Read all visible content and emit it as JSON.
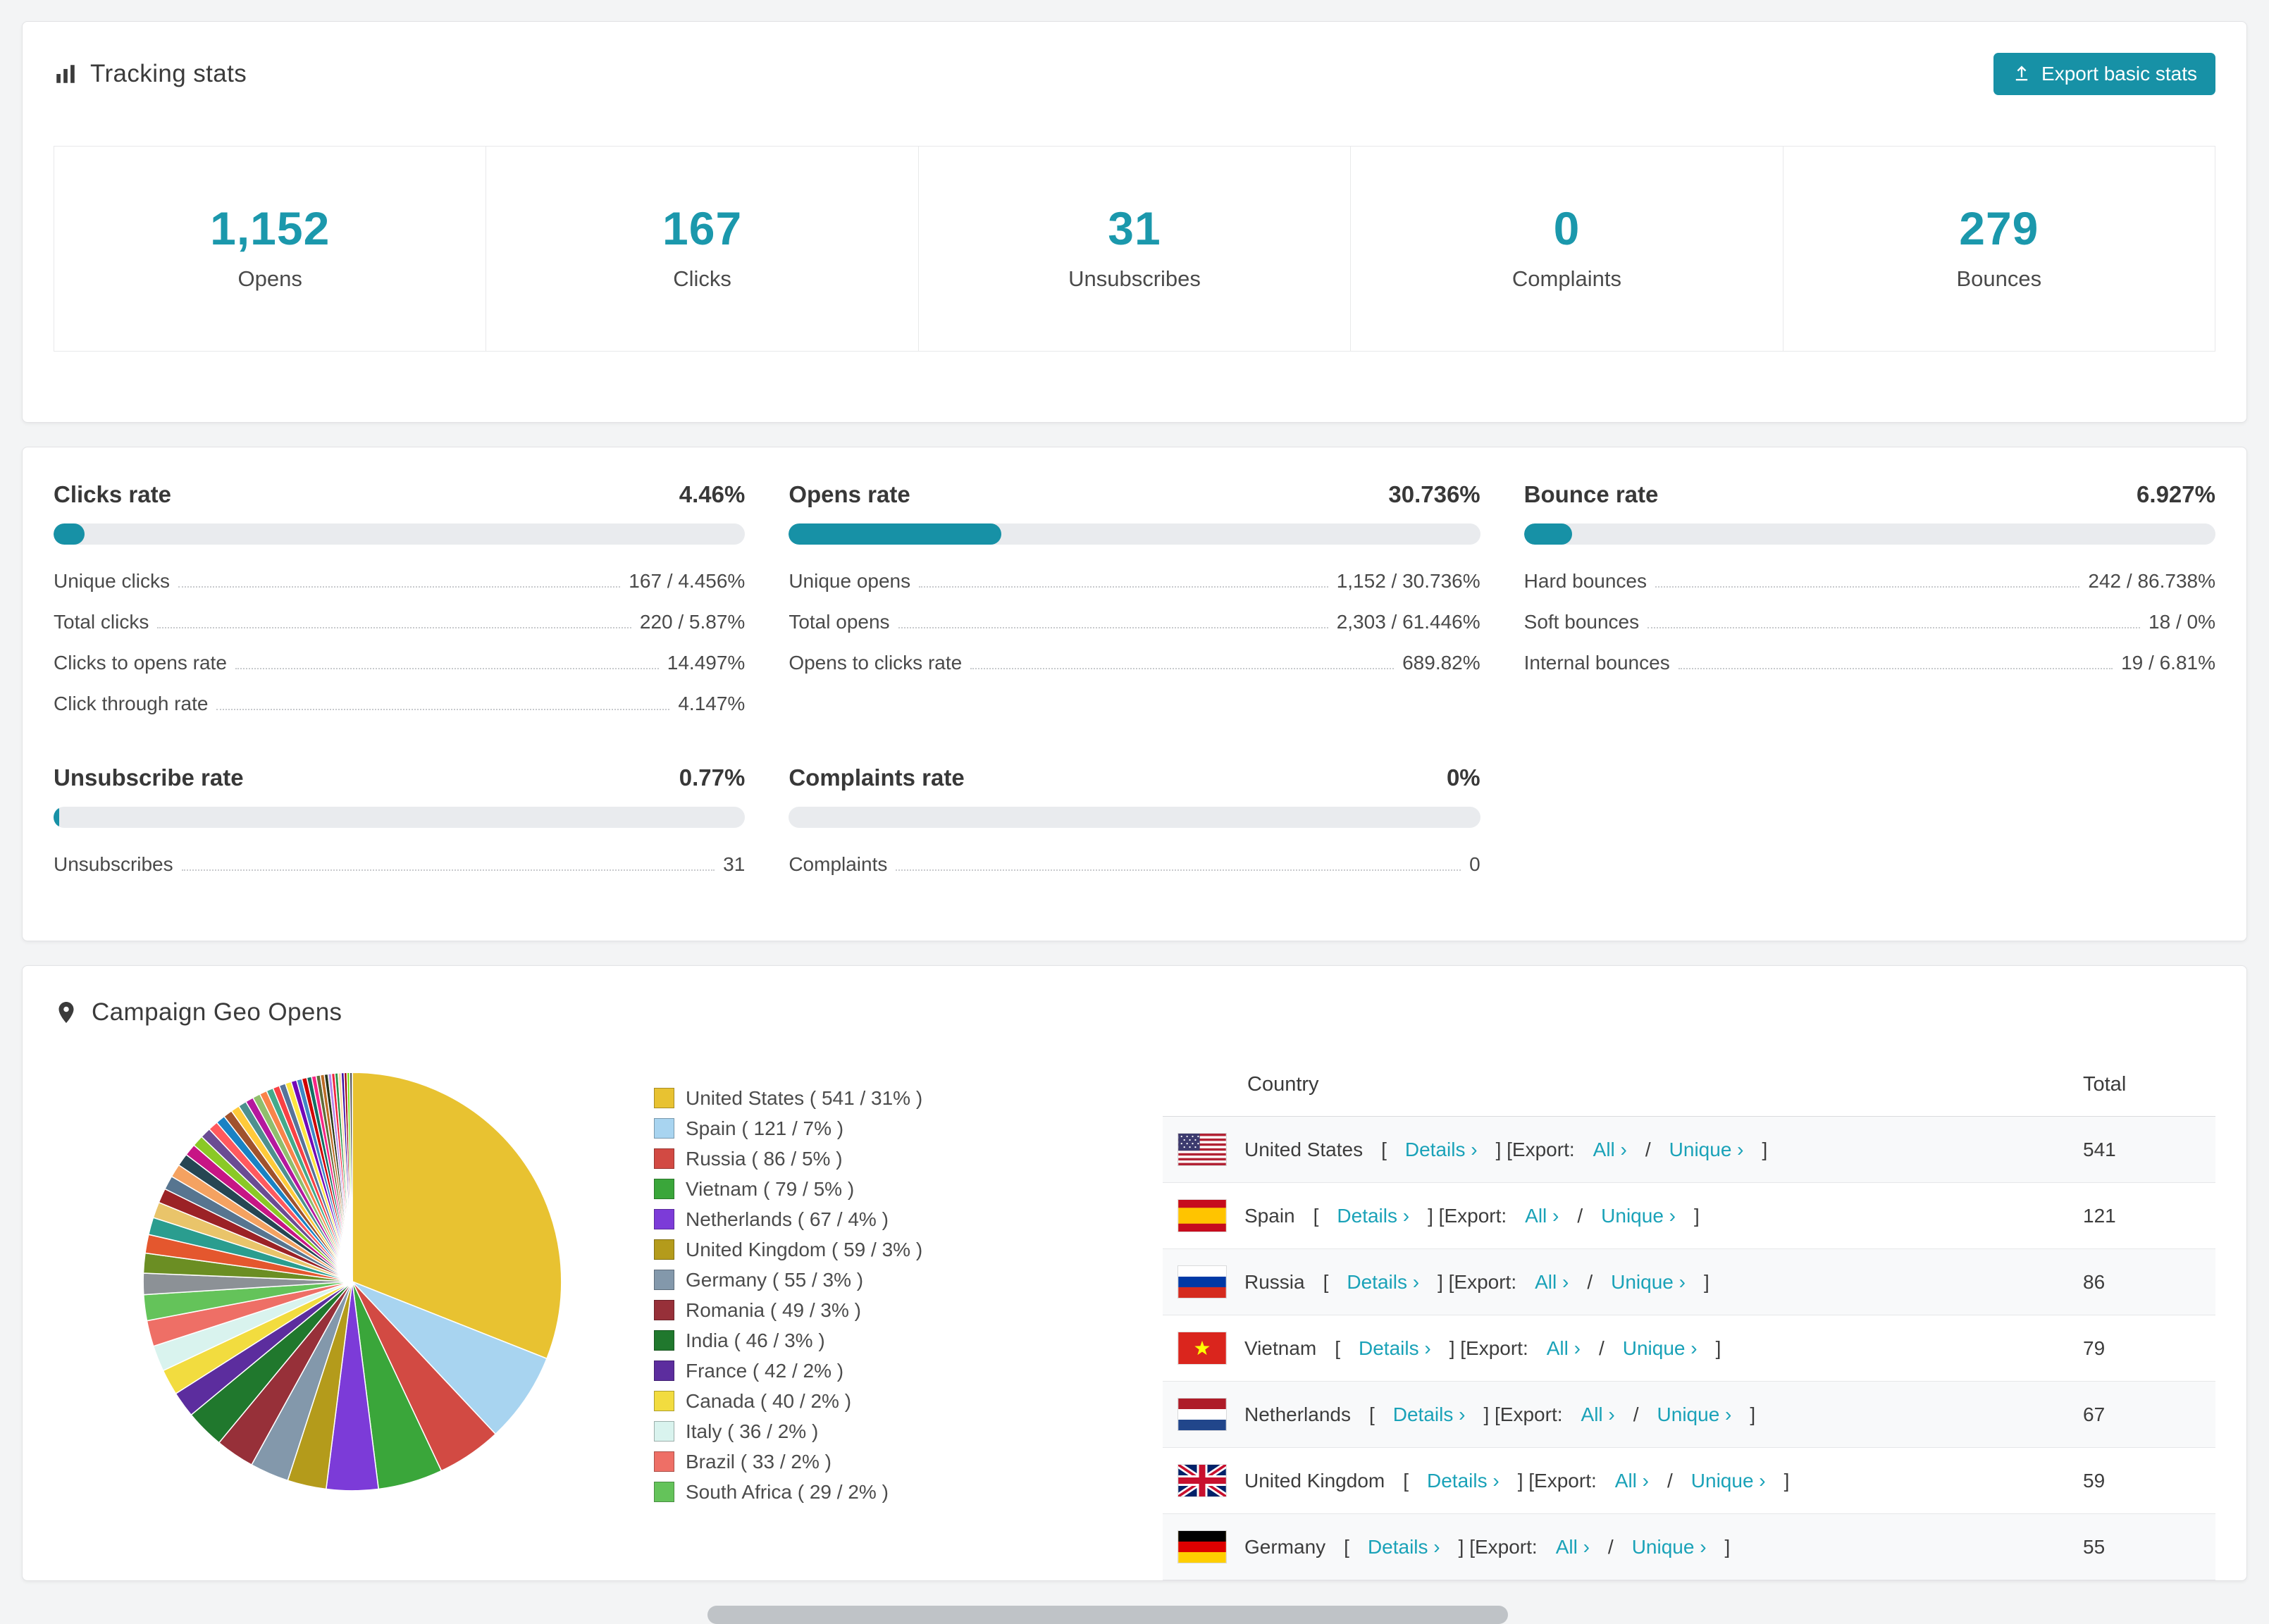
{
  "accent": "#1791a6",
  "tracking": {
    "title": "Tracking stats",
    "export_button": "Export basic stats",
    "stats": [
      {
        "value": "1,152",
        "label": "Opens"
      },
      {
        "value": "167",
        "label": "Clicks"
      },
      {
        "value": "31",
        "label": "Unsubscribes"
      },
      {
        "value": "0",
        "label": "Complaints"
      },
      {
        "value": "279",
        "label": "Bounces"
      }
    ]
  },
  "rates": [
    {
      "title": "Clicks rate",
      "value": "4.46%",
      "percent": 4.46,
      "rows": [
        {
          "label": "Unique clicks",
          "value": "167 / 4.456%"
        },
        {
          "label": "Total clicks",
          "value": "220 / 5.87%"
        },
        {
          "label": "Clicks to opens rate",
          "value": "14.497%"
        },
        {
          "label": "Click through rate",
          "value": "4.147%"
        }
      ]
    },
    {
      "title": "Opens rate",
      "value": "30.736%",
      "percent": 30.736,
      "rows": [
        {
          "label": "Unique opens",
          "value": "1,152 / 30.736%"
        },
        {
          "label": "Total opens",
          "value": "2,303 / 61.446%"
        },
        {
          "label": "Opens to clicks rate",
          "value": "689.82%"
        }
      ]
    },
    {
      "title": "Bounce rate",
      "value": "6.927%",
      "percent": 6.927,
      "rows": [
        {
          "label": "Hard bounces",
          "value": "242 / 86.738%"
        },
        {
          "label": "Soft bounces",
          "value": "18 / 0%"
        },
        {
          "label": "Internal bounces",
          "value": "19 / 6.81%"
        }
      ]
    },
    {
      "title": "Unsubscribe rate",
      "value": "0.77%",
      "percent": 0.77,
      "rows": [
        {
          "label": "Unsubscribes",
          "value": "31"
        }
      ]
    },
    {
      "title": "Complaints rate",
      "value": "0%",
      "percent": 0,
      "rows": [
        {
          "label": "Complaints",
          "value": "0"
        }
      ]
    }
  ],
  "geo": {
    "title": "Campaign Geo Opens",
    "chart_data": {
      "type": "pie",
      "title": "Campaign Geo Opens",
      "legend_position": "right",
      "slices": [
        {
          "name": "United States",
          "value": 541,
          "pct": 31,
          "color": "#e8c231"
        },
        {
          "name": "Spain",
          "value": 121,
          "pct": 7,
          "color": "#a8d4f0"
        },
        {
          "name": "Russia",
          "value": 86,
          "pct": 5,
          "color": "#d24a43"
        },
        {
          "name": "Vietnam",
          "value": 79,
          "pct": 5,
          "color": "#3aa63a"
        },
        {
          "name": "Netherlands",
          "value": 67,
          "pct": 4,
          "color": "#7c3bd8"
        },
        {
          "name": "United Kingdom",
          "value": 59,
          "pct": 3,
          "color": "#b49b1b"
        },
        {
          "name": "Germany",
          "value": 55,
          "pct": 3,
          "color": "#8398ab"
        },
        {
          "name": "Romania",
          "value": 49,
          "pct": 3,
          "color": "#973039"
        },
        {
          "name": "India",
          "value": 46,
          "pct": 3,
          "color": "#20782d"
        },
        {
          "name": "France",
          "value": 42,
          "pct": 2,
          "color": "#5c2d9e"
        },
        {
          "name": "Canada",
          "value": 40,
          "pct": 2,
          "color": "#f2dc3f"
        },
        {
          "name": "Italy",
          "value": 36,
          "pct": 2,
          "color": "#d9f3ee"
        },
        {
          "name": "Brazil",
          "value": 33,
          "pct": 2,
          "color": "#ee6f66"
        },
        {
          "name": "South Africa",
          "value": 29,
          "pct": 2,
          "color": "#64c35a"
        }
      ],
      "others": [
        {
          "pct": 1.6,
          "color": "#8c9196"
        },
        {
          "pct": 1.5,
          "color": "#6b8e23"
        },
        {
          "pct": 1.4,
          "color": "#e4572e"
        },
        {
          "pct": 1.3,
          "color": "#2a9d8f"
        },
        {
          "pct": 1.2,
          "color": "#e9c46a"
        },
        {
          "pct": 1.1,
          "color": "#9b2226"
        },
        {
          "pct": 1.05,
          "color": "#577590"
        },
        {
          "pct": 1.0,
          "color": "#f4a261"
        },
        {
          "pct": 0.95,
          "color": "#264653"
        },
        {
          "pct": 0.9,
          "color": "#c71585"
        },
        {
          "pct": 0.85,
          "color": "#8ac926"
        },
        {
          "pct": 0.8,
          "color": "#6a4c93"
        },
        {
          "pct": 0.75,
          "color": "#ff595e"
        },
        {
          "pct": 0.7,
          "color": "#1982c4"
        },
        {
          "pct": 0.68,
          "color": "#a0522d"
        },
        {
          "pct": 0.65,
          "color": "#ffca3a"
        },
        {
          "pct": 0.62,
          "color": "#4d908e"
        },
        {
          "pct": 0.6,
          "color": "#b5179e"
        },
        {
          "pct": 0.58,
          "color": "#90be6d"
        },
        {
          "pct": 0.55,
          "color": "#f9844a"
        },
        {
          "pct": 0.52,
          "color": "#43aa8b"
        },
        {
          "pct": 0.5,
          "color": "#f94144"
        },
        {
          "pct": 0.48,
          "color": "#577399"
        },
        {
          "pct": 0.45,
          "color": "#fee440"
        },
        {
          "pct": 0.42,
          "color": "#7209b7"
        },
        {
          "pct": 0.4,
          "color": "#3f88c5"
        },
        {
          "pct": 0.38,
          "color": "#d00000"
        },
        {
          "pct": 0.36,
          "color": "#136f63"
        },
        {
          "pct": 0.34,
          "color": "#f72585"
        },
        {
          "pct": 0.32,
          "color": "#606c38"
        },
        {
          "pct": 0.3,
          "color": "#bc6c25"
        },
        {
          "pct": 0.28,
          "color": "#283618"
        },
        {
          "pct": 0.26,
          "color": "#b388eb"
        },
        {
          "pct": 0.25,
          "color": "#ef233c"
        },
        {
          "pct": 0.24,
          "color": "#2b9348"
        },
        {
          "pct": 0.23,
          "color": "#ffd6a5"
        },
        {
          "pct": 0.22,
          "color": "#3a0ca3"
        },
        {
          "pct": 0.21,
          "color": "#9d0208"
        },
        {
          "pct": 0.2,
          "color": "#70e000"
        },
        {
          "pct": 0.2,
          "color": "#555555"
        }
      ]
    },
    "table": {
      "columns": [
        "Country",
        "Total"
      ],
      "links": {
        "details": "Details ›",
        "all": "All ›",
        "unique": "Unique ›"
      },
      "fmt": {
        "lb": "[",
        "rb": "]",
        "export": "Export:",
        "slash": "/"
      },
      "rows": [
        {
          "country": "United States",
          "total": "541",
          "flag": "us"
        },
        {
          "country": "Spain",
          "total": "121",
          "flag": "es"
        },
        {
          "country": "Russia",
          "total": "86",
          "flag": "ru"
        },
        {
          "country": "Vietnam",
          "total": "79",
          "flag": "vn"
        },
        {
          "country": "Netherlands",
          "total": "67",
          "flag": "nl"
        },
        {
          "country": "United Kingdom",
          "total": "59",
          "flag": "gb"
        },
        {
          "country": "Germany",
          "total": "55",
          "flag": "de"
        }
      ]
    }
  }
}
